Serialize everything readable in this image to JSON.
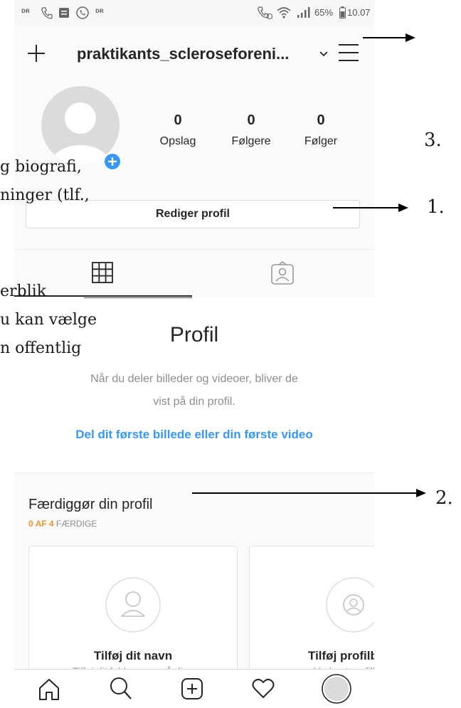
{
  "status_bar": {
    "left_icons": [
      "dr-icon",
      "phone-icon",
      "message-icon",
      "whatsapp-icon",
      "dr-icon"
    ],
    "battery": "65%",
    "time": "10.07"
  },
  "top_bar": {
    "username": "praktikants_scleroseforeni...",
    "dropdown_caret": "⌄"
  },
  "profile": {
    "stats": [
      {
        "value": "0",
        "label": "Opslag"
      },
      {
        "value": "0",
        "label": "Følgere"
      },
      {
        "value": "0",
        "label": "Følger"
      }
    ],
    "edit_button": "Rediger profil"
  },
  "empty_state": {
    "title": "Profil",
    "body_line1": "Når du deler billeder og videoer, bliver de",
    "body_line2": "vist på din profil.",
    "link": "Del dit første billede eller din første video"
  },
  "complete_profile": {
    "title": "Færdiggør din profil",
    "progress_highlight": "0 AF 4",
    "progress_rest": " FÆRDIGE",
    "cards": [
      {
        "title": "Tilføj dit navn",
        "subtitle": "Tilføj dit fulde navn, så dine"
      },
      {
        "title": "Tilføj profilb",
        "subtitle": "Vælg et profilbill"
      }
    ]
  },
  "annotations": {
    "overlay_fragments": [
      "g biografi,",
      "ninger (tlf.,",
      "erblik",
      "u kan vælge",
      "n offentlig"
    ],
    "labels": [
      "3.",
      "1.",
      "2."
    ]
  },
  "colors": {
    "accent_blue": "#3897f0",
    "progress_orange": "#f09433",
    "link_blue": "#3897f0"
  }
}
